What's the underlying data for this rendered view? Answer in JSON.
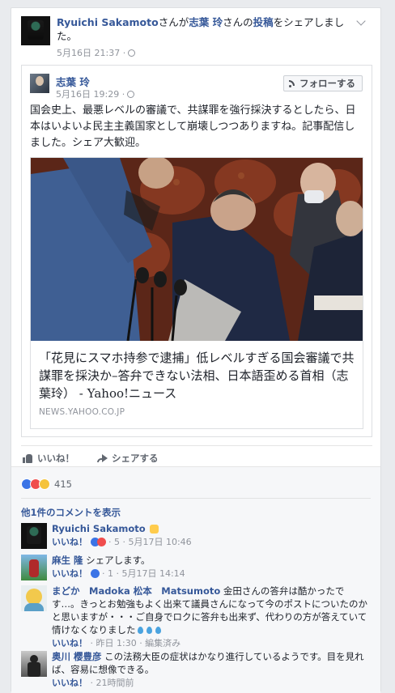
{
  "header": {
    "sharer": "Ryuichi Sakamoto",
    "mid1": "さんが",
    "author": "志葉 玲",
    "mid2": "さんの",
    "post_link": "投稿",
    "tail": "をシェアしました。",
    "time": "5月16日 21:37 ·"
  },
  "shared_post": {
    "name": "志葉 玲",
    "time": "5月16日 19:29 ·",
    "follow_label": "フォローする",
    "text": "国会史上、最悪レベルの審議で、共謀罪を強行採決するとしたら、日本はいよいよ民主主義国家として崩壊しつつありますね。記事配信しました。シェア大歓迎。",
    "article": {
      "title": "「花見にスマホ持参で逮捕」低レベルすぎる国会審議で共謀罪を採決か–答弁できない法相、日本語歪める首相（志葉玲） - Yahoo!ニュース",
      "source": "NEWS.YAHOO.CO.JP"
    }
  },
  "actions": {
    "like": "いいね！",
    "share": "シェアする"
  },
  "reactions": {
    "count": "415",
    "colors": [
      "#3b74e6",
      "#f04d4d",
      "#f5c33b"
    ]
  },
  "more_comments": "他1件のコメントを表示",
  "comments": [
    {
      "name": "Ryuichi Sakamoto",
      "text": "",
      "like": "いいね！",
      "meta": "· 5 · 5月17日 10:46"
    },
    {
      "name": "麻生 隆",
      "text": "シェアします。",
      "like": "いいね！",
      "meta": "· 1 · 5月17日 14:14"
    },
    {
      "name": "まどか　Madoka 松本　Matsumoto",
      "text": "金田さんの答弁は酷かったです…。きっとお勉強もよく出来て議員さんになって今のポストについたのかと思いますが・・・ご自身でロクに答弁も出来ず、代わりの方が答えていて情けなくなりました",
      "like": "いいね！",
      "meta": "· 昨日 1:30 · 編集済み"
    },
    {
      "name": "奥川 樱豊彦",
      "text": "この法務大臣の症状はかなり進行しているようです。目を見れば、容易に想像できる。",
      "like": "いいね！",
      "meta": "· 21時間前"
    }
  ]
}
